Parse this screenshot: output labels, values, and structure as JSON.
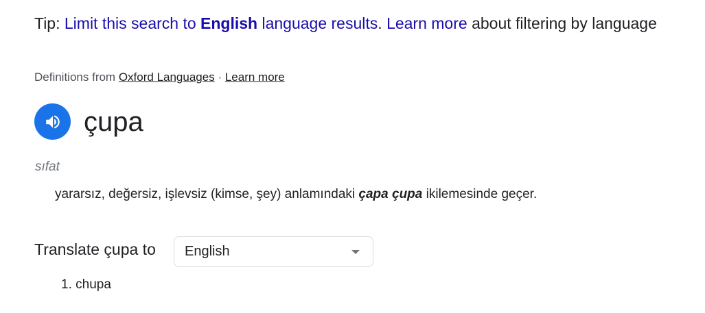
{
  "tip": {
    "prefix": "Tip: ",
    "link1_part1": "Limit this search to ",
    "link1_bold": "English",
    "link1_part2": " language results",
    "separator": ". ",
    "learn_more": "Learn more",
    "suffix": " about filtering by language"
  },
  "source": {
    "prefix": "Definitions from ",
    "provider": "Oxford Languages",
    "dot": " · ",
    "learn_more": "Learn more"
  },
  "entry": {
    "word": "çupa",
    "part_of_speech": "sıfat",
    "definition_before": "yararsız, değersiz, işlevsiz (kimse, şey) anlamındaki ",
    "definition_emphasis": "çapa çupa",
    "definition_after": " ikilemesinde geçer."
  },
  "translate": {
    "label": "Translate çupa to",
    "selected_language": "English",
    "results": [
      "1. chupa"
    ]
  },
  "colors": {
    "link": "#1a0dab",
    "speaker_button": "#1a73e8"
  },
  "icons": {
    "speaker": "speaker-icon",
    "dropdown": "chevron-down-icon"
  }
}
